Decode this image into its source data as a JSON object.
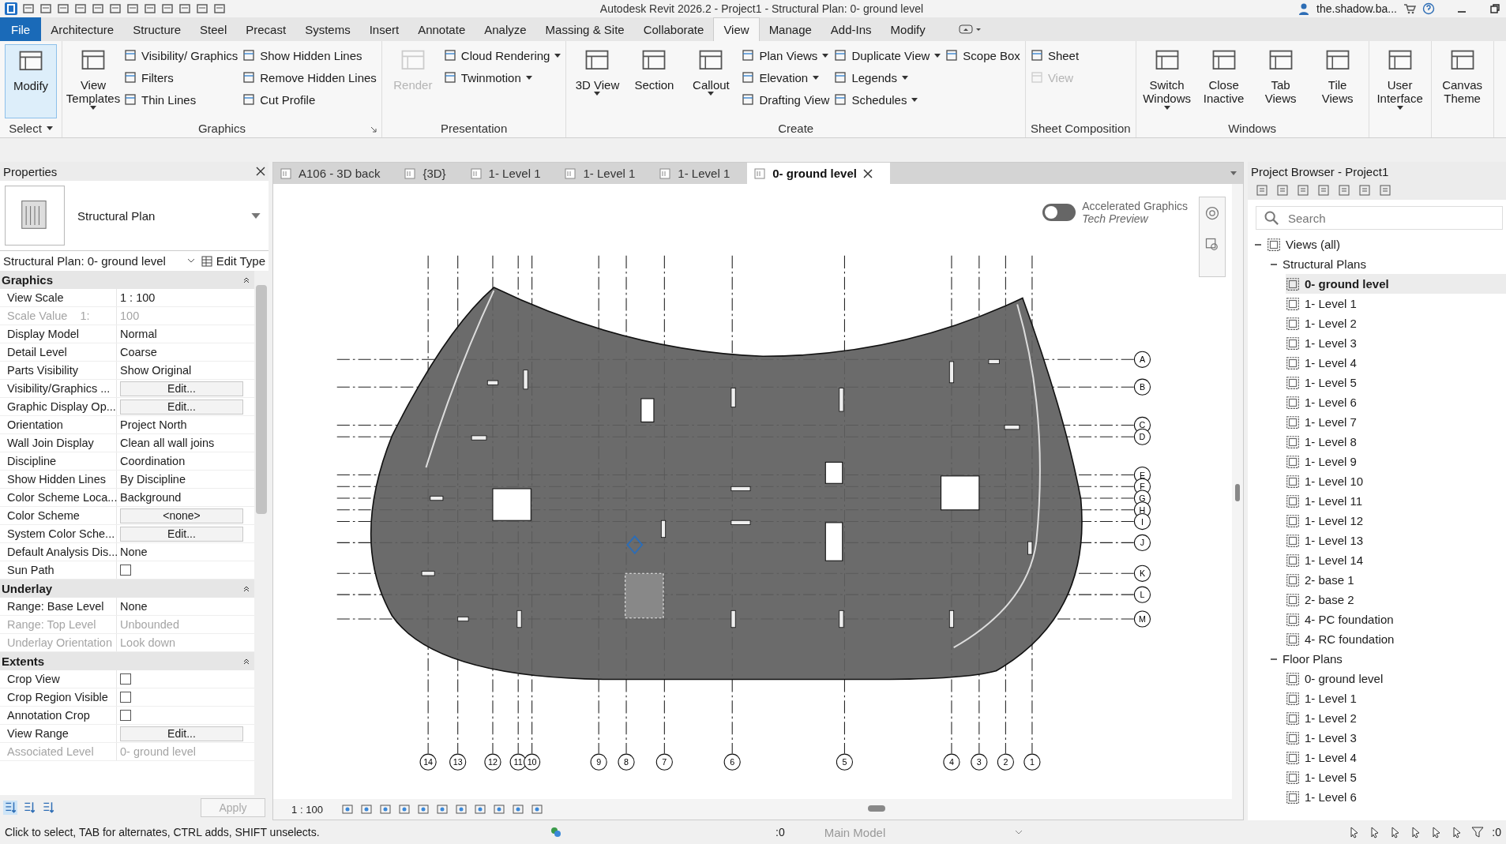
{
  "title_bar": {
    "title": "Autodesk Revit 2026.2 - Project1 - Structural Plan: 0- ground level",
    "user": "the.shadow.ba..."
  },
  "ribbon_tabs": [
    {
      "label": "File",
      "kind": "file",
      "selected": false
    },
    {
      "label": "Architecture",
      "kind": "tab",
      "selected": false
    },
    {
      "label": "Structure",
      "kind": "tab",
      "selected": false
    },
    {
      "label": "Steel",
      "kind": "tab",
      "selected": false
    },
    {
      "label": "Precast",
      "kind": "tab",
      "selected": false
    },
    {
      "label": "Systems",
      "kind": "tab",
      "selected": false
    },
    {
      "label": "Insert",
      "kind": "tab",
      "selected": false
    },
    {
      "label": "Annotate",
      "kind": "tab",
      "selected": false
    },
    {
      "label": "Analyze",
      "kind": "tab",
      "selected": false
    },
    {
      "label": "Massing & Site",
      "kind": "tab",
      "selected": false
    },
    {
      "label": "Collaborate",
      "kind": "tab",
      "selected": false
    },
    {
      "label": "View",
      "kind": "tab",
      "selected": true
    },
    {
      "label": "Manage",
      "kind": "tab",
      "selected": false
    },
    {
      "label": "Add-Ins",
      "kind": "tab",
      "selected": false
    },
    {
      "label": "Modify",
      "kind": "tab",
      "selected": false
    }
  ],
  "ribbon_panels": [
    {
      "title": "Select",
      "title_dropdown": true,
      "launcher": false,
      "items": [
        {
          "label": "Modify",
          "kind": "large",
          "dropdown": false,
          "disabled": false,
          "selected": true
        }
      ]
    },
    {
      "title": "Graphics",
      "title_dropdown": false,
      "launcher": true,
      "items": [
        {
          "label": "View Templates",
          "kind": "large",
          "dropdown": true,
          "disabled": false,
          "selected": false
        },
        {
          "label": "Visibility/ Graphics",
          "kind": "small",
          "dropdown": false,
          "disabled": false
        },
        {
          "label": "Filters",
          "kind": "small",
          "dropdown": false,
          "disabled": false
        },
        {
          "label": "Thin Lines",
          "kind": "small",
          "dropdown": false,
          "disabled": false
        },
        {
          "label": "Show Hidden Lines",
          "kind": "small",
          "dropdown": false,
          "disabled": false
        },
        {
          "label": "Remove Hidden Lines",
          "kind": "small",
          "dropdown": false,
          "disabled": false
        },
        {
          "label": "Cut Profile",
          "kind": "small",
          "dropdown": false,
          "disabled": false
        }
      ]
    },
    {
      "title": "Presentation",
      "title_dropdown": false,
      "launcher": false,
      "items": [
        {
          "label": "Render",
          "kind": "large",
          "dropdown": false,
          "disabled": true,
          "selected": false
        },
        {
          "label": "Cloud Rendering",
          "kind": "small",
          "dropdown": true,
          "disabled": false
        },
        {
          "label": "Twinmotion",
          "kind": "small",
          "dropdown": true,
          "disabled": false
        }
      ]
    },
    {
      "title": "Create",
      "title_dropdown": false,
      "launcher": false,
      "items": [
        {
          "label": "3D View",
          "kind": "large",
          "dropdown": true,
          "disabled": false,
          "selected": false
        },
        {
          "label": "Section",
          "kind": "large",
          "dropdown": false,
          "disabled": false,
          "selected": false
        },
        {
          "label": "Callout",
          "kind": "large",
          "dropdown": true,
          "disabled": false,
          "selected": false
        },
        {
          "label": "Plan Views",
          "kind": "small",
          "dropdown": true,
          "disabled": false
        },
        {
          "label": "Elevation",
          "kind": "small",
          "dropdown": true,
          "disabled": false
        },
        {
          "label": "Drafting View",
          "kind": "small",
          "dropdown": false,
          "disabled": false
        },
        {
          "label": "Duplicate View",
          "kind": "small",
          "dropdown": true,
          "disabled": false
        },
        {
          "label": "Legends",
          "kind": "small",
          "dropdown": true,
          "disabled": false
        },
        {
          "label": "Schedules",
          "kind": "small",
          "dropdown": true,
          "disabled": false
        },
        {
          "label": "Scope Box",
          "kind": "small",
          "dropdown": false,
          "disabled": false
        }
      ]
    },
    {
      "title": "Sheet Composition",
      "title_dropdown": false,
      "launcher": false,
      "items": [
        {
          "label": "Sheet",
          "kind": "small",
          "dropdown": false,
          "disabled": false
        },
        {
          "label": "View",
          "kind": "small",
          "dropdown": false,
          "disabled": true
        }
      ]
    },
    {
      "title": "Windows",
      "title_dropdown": false,
      "launcher": false,
      "items": [
        {
          "label": "Switch Windows",
          "kind": "large",
          "dropdown": true,
          "disabled": false,
          "selected": false
        },
        {
          "label": "Close Inactive",
          "kind": "large",
          "dropdown": false,
          "disabled": false,
          "selected": false
        },
        {
          "label": "Tab Views",
          "kind": "large",
          "dropdown": false,
          "disabled": false,
          "selected": false
        },
        {
          "label": "Tile Views",
          "kind": "large",
          "dropdown": false,
          "disabled": false,
          "selected": false
        }
      ]
    },
    {
      "items": [
        {
          "label": "User Interface",
          "kind": "large",
          "dropdown": true,
          "disabled": false,
          "selected": false
        }
      ]
    },
    {
      "items": [
        {
          "label": "Canvas Theme",
          "kind": "large",
          "dropdown": false,
          "disabled": false,
          "selected": false
        }
      ]
    }
  ],
  "properties": {
    "title": "Properties",
    "type": "Structural Plan",
    "instance": "Structural Plan: 0- ground level",
    "edit_type": "Edit Type",
    "sections": [
      {
        "title": "Graphics",
        "rows": [
          {
            "name": "View Scale",
            "value": "1 : 100",
            "kind": "text",
            "disabled": false
          },
          {
            "name": "Scale Value    1:",
            "value": "100",
            "kind": "text",
            "disabled": true
          },
          {
            "name": "Display Model",
            "value": "Normal",
            "kind": "text",
            "disabled": false
          },
          {
            "name": "Detail Level",
            "value": "Coarse",
            "kind": "text",
            "disabled": false
          },
          {
            "name": "Parts Visibility",
            "value": "Show Original",
            "kind": "text",
            "disabled": false
          },
          {
            "name": "Visibility/Graphics ...",
            "value": "Edit...",
            "kind": "button",
            "disabled": false
          },
          {
            "name": "Graphic Display Op...",
            "value": "Edit...",
            "kind": "button",
            "disabled": false
          },
          {
            "name": "Orientation",
            "value": "Project North",
            "kind": "text",
            "disabled": false
          },
          {
            "name": "Wall Join Display",
            "value": "Clean all wall joins",
            "kind": "text",
            "disabled": false
          },
          {
            "name": "Discipline",
            "value": "Coordination",
            "kind": "text",
            "disabled": false
          },
          {
            "name": "Show Hidden Lines",
            "value": "By Discipline",
            "kind": "text",
            "disabled": false
          },
          {
            "name": "Color Scheme Loca...",
            "value": "Background",
            "kind": "text",
            "disabled": false
          },
          {
            "name": "Color Scheme",
            "value": "<none>",
            "kind": "button",
            "disabled": false
          },
          {
            "name": "System Color Sche...",
            "value": "Edit...",
            "kind": "button",
            "disabled": false
          },
          {
            "name": "Default Analysis Dis...",
            "value": "None",
            "kind": "text",
            "disabled": false
          },
          {
            "name": "Sun Path",
            "kind": "checkbox",
            "checked": false,
            "disabled": false
          }
        ]
      },
      {
        "title": "Underlay",
        "rows": [
          {
            "name": "Range: Base Level",
            "value": "None",
            "kind": "text",
            "disabled": false
          },
          {
            "name": "Range: Top Level",
            "value": "Unbounded",
            "kind": "text",
            "disabled": true
          },
          {
            "name": "Underlay Orientation",
            "value": "Look down",
            "kind": "text",
            "disabled": true
          }
        ]
      },
      {
        "title": "Extents",
        "rows": [
          {
            "name": "Crop View",
            "kind": "checkbox",
            "checked": false,
            "disabled": false
          },
          {
            "name": "Crop Region Visible",
            "kind": "checkbox",
            "checked": false,
            "disabled": false
          },
          {
            "name": "Annotation Crop",
            "kind": "checkbox",
            "checked": false,
            "disabled": false
          },
          {
            "name": "View Range",
            "value": "Edit...",
            "kind": "button",
            "disabled": false
          },
          {
            "name": "Associated Level",
            "value": "0- ground level",
            "kind": "text",
            "disabled": true
          }
        ]
      }
    ],
    "apply": {
      "label": "Apply",
      "disabled": true
    }
  },
  "view_tabs": [
    {
      "label": "A106 - 3D back",
      "selected": false
    },
    {
      "label": "{3D}",
      "selected": false
    },
    {
      "label": "1- Level 1",
      "selected": false
    },
    {
      "label": "1- Level 1",
      "selected": false
    },
    {
      "label": "1- Level 1",
      "selected": false
    },
    {
      "label": "0- ground level",
      "selected": true
    }
  ],
  "graphics_toggle": {
    "label": "Accelerated Graphics",
    "sublabel": "Tech Preview",
    "on": false
  },
  "plan": {
    "grid_columns": [
      "14",
      "13",
      "12",
      "11",
      "10",
      "9",
      "8",
      "7",
      "6",
      "5",
      "4",
      "3",
      "2",
      "1"
    ],
    "grid_rows": [
      "A",
      "B",
      "C",
      "D",
      "E",
      "F",
      "G",
      "H",
      "I",
      "J",
      "K",
      "L",
      "M"
    ]
  },
  "view_scale": "1 : 100",
  "project_browser": {
    "title": "Project Browser - Project1",
    "search": {
      "placeholder": "Search"
    },
    "tree": [
      {
        "label": "Views (all)",
        "expanded": true,
        "children": [
          {
            "label": "Structural Plans",
            "expanded": true,
            "children": [
              {
                "label": "0- ground level",
                "selected": true
              },
              {
                "label": "1- Level 1",
                "selected": false
              },
              {
                "label": "1- Level 2",
                "selected": false
              },
              {
                "label": "1- Level 3",
                "selected": false
              },
              {
                "label": "1- Level 4",
                "selected": false
              },
              {
                "label": "1- Level 5",
                "selected": false
              },
              {
                "label": "1- Level 6",
                "selected": false
              },
              {
                "label": "1- Level 7",
                "selected": false
              },
              {
                "label": "1- Level 8",
                "selected": false
              },
              {
                "label": "1- Level 9",
                "selected": false
              },
              {
                "label": "1- Level 10",
                "selected": false
              },
              {
                "label": "1- Level 11",
                "selected": false
              },
              {
                "label": "1- Level 12",
                "selected": false
              },
              {
                "label": "1- Level 13",
                "selected": false
              },
              {
                "label": "1- Level 14",
                "selected": false
              },
              {
                "label": "2- base 1",
                "selected": false
              },
              {
                "label": "2- base 2",
                "selected": false
              },
              {
                "label": "4- PC foundation",
                "selected": false
              },
              {
                "label": "4- RC foundation",
                "selected": false
              }
            ]
          },
          {
            "label": "Floor Plans",
            "expanded": true,
            "children": [
              {
                "label": "0- ground level",
                "selected": false
              },
              {
                "label": "1- Level 1",
                "selected": false
              },
              {
                "label": "1- Level 2",
                "selected": false
              },
              {
                "label": "1- Level 3",
                "selected": false
              },
              {
                "label": "1- Level 4",
                "selected": false
              },
              {
                "label": "1- Level 5",
                "selected": false
              },
              {
                "label": "1- Level 6",
                "selected": false
              }
            ]
          }
        ]
      }
    ]
  },
  "status_bar": {
    "message": "Click to select, TAB for alternates, CTRL adds, SHIFT unselects.",
    "selection_count": ":0",
    "workset": "Main Model",
    "filter_count": ":0"
  }
}
